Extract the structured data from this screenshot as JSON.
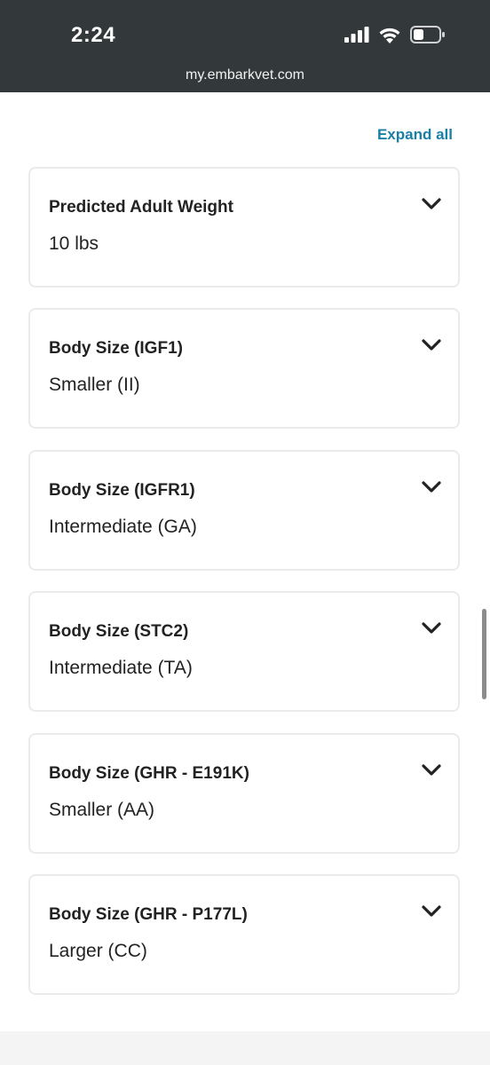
{
  "status_bar": {
    "time": "2:24",
    "url": "my.embarkvet.com",
    "icons": [
      "signal-icon",
      "wifi-icon",
      "battery-icon"
    ]
  },
  "header": {
    "expand_all_label": "Expand all"
  },
  "cards": [
    {
      "title": "Predicted Adult Weight",
      "value": "10 lbs"
    },
    {
      "title": "Body Size (IGF1)",
      "value": "Smaller (II)"
    },
    {
      "title": "Body Size (IGFR1)",
      "value": "Intermediate (GA)"
    },
    {
      "title": "Body Size (STC2)",
      "value": "Intermediate (TA)"
    },
    {
      "title": "Body Size (GHR - E191K)",
      "value": "Smaller (AA)"
    },
    {
      "title": "Body Size (GHR - P177L)",
      "value": "Larger (CC)"
    }
  ],
  "colors": {
    "status_bar_bg": "#33383a",
    "accent": "#1a7fa6",
    "card_border": "#ebebeb",
    "text": "#222222"
  }
}
